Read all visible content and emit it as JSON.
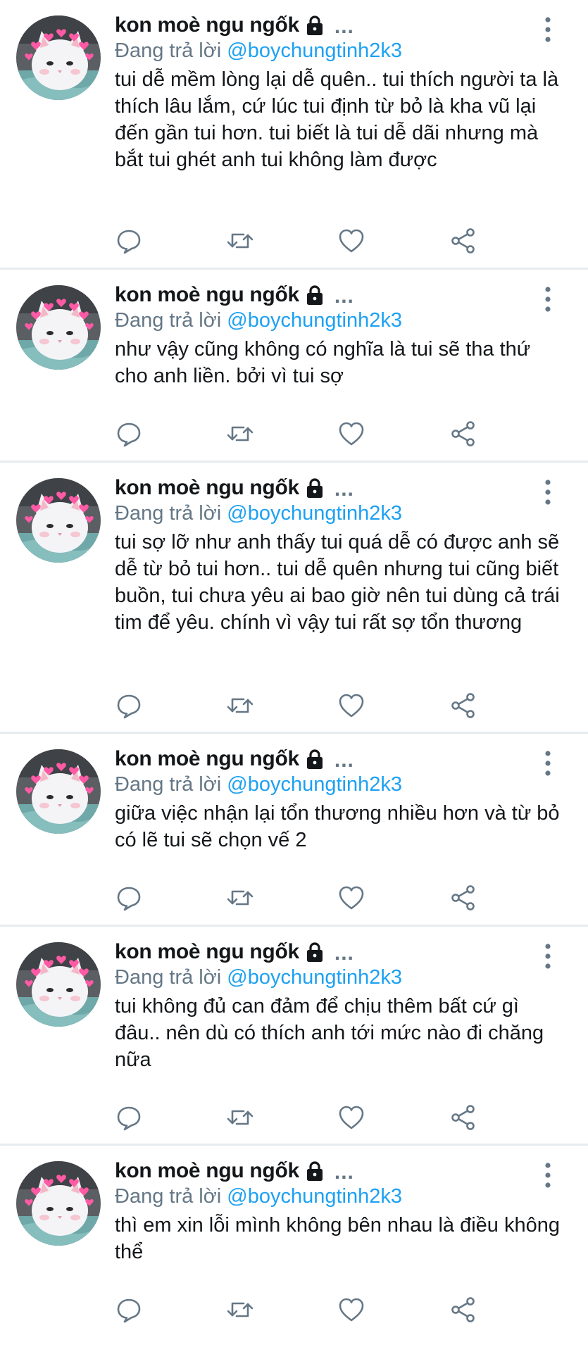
{
  "icons": {
    "avatar": "white-cat-with-pink-hearts-avatar",
    "lock": "lock-icon",
    "more": "vertical-ellipsis-icon",
    "reply": "reply-bubble-icon",
    "retweet": "retweet-icon",
    "like": "heart-icon",
    "share": "share-icon"
  },
  "colors": {
    "name": "#14171a",
    "secondary": "#657786",
    "handle": "#1da1f2",
    "divider": "#e6ecf0"
  },
  "tweets": [
    {
      "name": "kon moè ngu ngốk",
      "dots": "...",
      "reply_prefix": "Đang trả lời ",
      "reply_handle": "@boychungtinh2k3",
      "text": "tui dễ mềm lòng lại dễ quên.. tui thích người ta là thích lâu lắm, cứ lúc tui định từ bỏ là kha vũ lại đến gần tui hơn. tui biết là tui dễ dãi nhưng mà bắt tui ghét anh tui không làm được"
    },
    {
      "name": "kon moè ngu ngốk",
      "dots": "...",
      "reply_prefix": "Đang trả lời ",
      "reply_handle": "@boychungtinh2k3",
      "text": "như vậy cũng không có nghĩa là tui sẽ tha thứ cho anh liền. bởi vì tui sợ"
    },
    {
      "name": "kon moè ngu ngốk",
      "dots": "...",
      "reply_prefix": "Đang trả lời ",
      "reply_handle": "@boychungtinh2k3",
      "text": "tui sợ lỡ như anh thấy tui quá dễ có được anh sẽ dễ từ bỏ tui hơn.. tui dễ quên nhưng tui cũng biết buồn, tui chưa yêu ai bao giờ nên tui dùng cả trái tim để yêu. chính vì vậy tui rất sợ tổn thương"
    },
    {
      "name": "kon moè ngu ngốk",
      "dots": "...",
      "reply_prefix": "Đang trả lời ",
      "reply_handle": "@boychungtinh2k3",
      "text": "giữa việc nhận lại tổn thương nhiều hơn và từ bỏ có lẽ tui sẽ chọn vế 2"
    },
    {
      "name": "kon moè ngu ngốk",
      "dots": "...",
      "reply_prefix": "Đang trả lời ",
      "reply_handle": "@boychungtinh2k3",
      "text": "tui không đủ can đảm để chịu thêm bất cứ gì đâu.. nên dù có thích anh tới mức nào đi chăng nữa"
    },
    {
      "name": "kon moè ngu ngốk",
      "dots": "...",
      "reply_prefix": "Đang trả lời ",
      "reply_handle": "@boychungtinh2k3",
      "text": "thì em xin lỗi mình không bên nhau là điều không thể"
    }
  ]
}
